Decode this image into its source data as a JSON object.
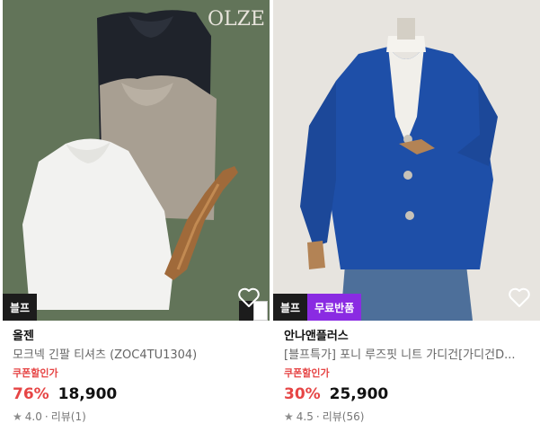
{
  "products": [
    {
      "brand": "올젠",
      "name": "모크넥 긴팔 티셔츠 (ZOC4TU1304)",
      "coupon_label": "쿠폰할인가",
      "discount": "76%",
      "price": "18,900",
      "rating": "4.0",
      "reviews": "리뷰(1)",
      "badges": [
        "블프"
      ],
      "image_watermark": "OLZE",
      "colors": {
        "bg": "#5f7056",
        "navy": "#1f232b",
        "beige": "#a89f92",
        "white": "#f2f2f0"
      }
    },
    {
      "brand": "안나앤플러스",
      "name": "[블프특가] 포니 루즈핏 니트 가디건[가디건D...",
      "coupon_label": "쿠폰할인가",
      "discount": "30%",
      "price": "25,900",
      "rating": "4.5",
      "reviews": "리뷰(56)",
      "badges": [
        "블프",
        "무료반품"
      ],
      "colors": {
        "bg": "#e7e4df",
        "cardigan": "#1e4fa8",
        "jeans": "#4d6f9a"
      }
    }
  ],
  "accent": {
    "discount": "#e64545",
    "badge_dark": "#1c1c1c",
    "badge_purple": "#8a2be2"
  },
  "icons": {
    "wishlist": "heart-icon",
    "rating": "star-icon"
  }
}
